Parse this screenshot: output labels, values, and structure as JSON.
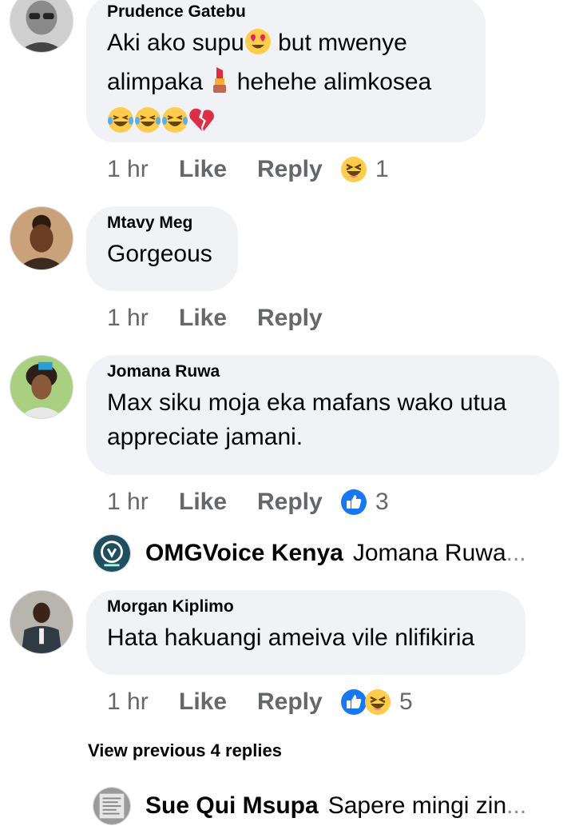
{
  "comments": [
    {
      "author": "Prudence Gatebu",
      "text_a": "Aki ako supu",
      "text_b": " but mwenye",
      "text_c": "alimpaka ",
      "text_d": " hehehe alimkosea",
      "time": "1 hr",
      "like": "Like",
      "reply": "Reply",
      "reaction_count": "1",
      "reactions": [
        "laughing-face-icon"
      ]
    },
    {
      "author": "Mtavy Meg",
      "text": "Gorgeous",
      "time": "1 hr",
      "like": "Like",
      "reply": "Reply"
    },
    {
      "author": "Jomana Ruwa",
      "text_a": "Max siku moja eka mafans wako utua",
      "text_b": "appreciate jamani.",
      "time": "1 hr",
      "like": "Like",
      "reply": "Reply",
      "reaction_count": "3",
      "reactions": [
        "thumbs-up-icon"
      ],
      "reply_preview": {
        "name": "OMGVoice Kenya",
        "text": "Jomana Ruwa",
        "ellipsis": "..."
      }
    },
    {
      "author": "Morgan Kiplimo",
      "text": "Hata hakuangi ameiva vile nlifikiria",
      "time": "1 hr",
      "like": "Like",
      "reply": "Reply",
      "reaction_count": "5",
      "reactions": [
        "thumbs-up-icon",
        "laughing-face-icon"
      ],
      "view_previous": "View previous 4 replies",
      "reply_preview": {
        "name": "Sue Qui Msupa",
        "text": "Sapere mingi zin",
        "ellipsis": "..."
      }
    }
  ],
  "colors": {
    "bubble": "#f0f2f5",
    "meta_text": "#65676b",
    "like_blue": "#1877f2",
    "emoji_yellow": "#ffcc4d",
    "omg_logo_bg": "#1f4e5f"
  }
}
